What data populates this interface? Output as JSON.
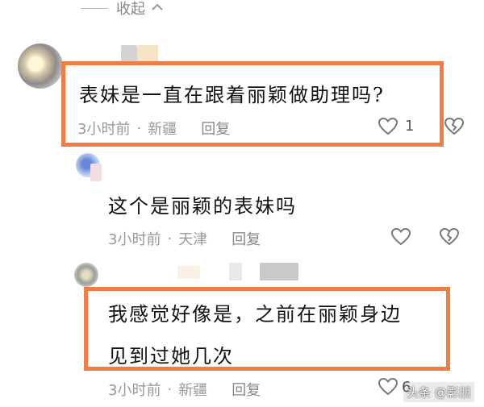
{
  "collapse": {
    "label": "收起"
  },
  "comments": [
    {
      "text": "表妹是一直在跟着丽颖做助理吗?",
      "time": "3小时前",
      "location": "新疆",
      "reply_label": "回复",
      "like_count": "1"
    },
    {
      "text": "这个是丽颖的表妹吗",
      "time": "3小时前",
      "location": "天津",
      "reply_label": "回复"
    },
    {
      "text_line1": "我感觉好像是，之前在丽颖身边",
      "text_line2": "见到过她几次",
      "time": "3小时前",
      "location": "新疆",
      "reply_label": "回复",
      "like_count": "6"
    }
  ],
  "separator": "·",
  "watermark": "头条 @影朋",
  "colors": {
    "highlight_border": "#f07d42",
    "meta_text": "#999999"
  }
}
